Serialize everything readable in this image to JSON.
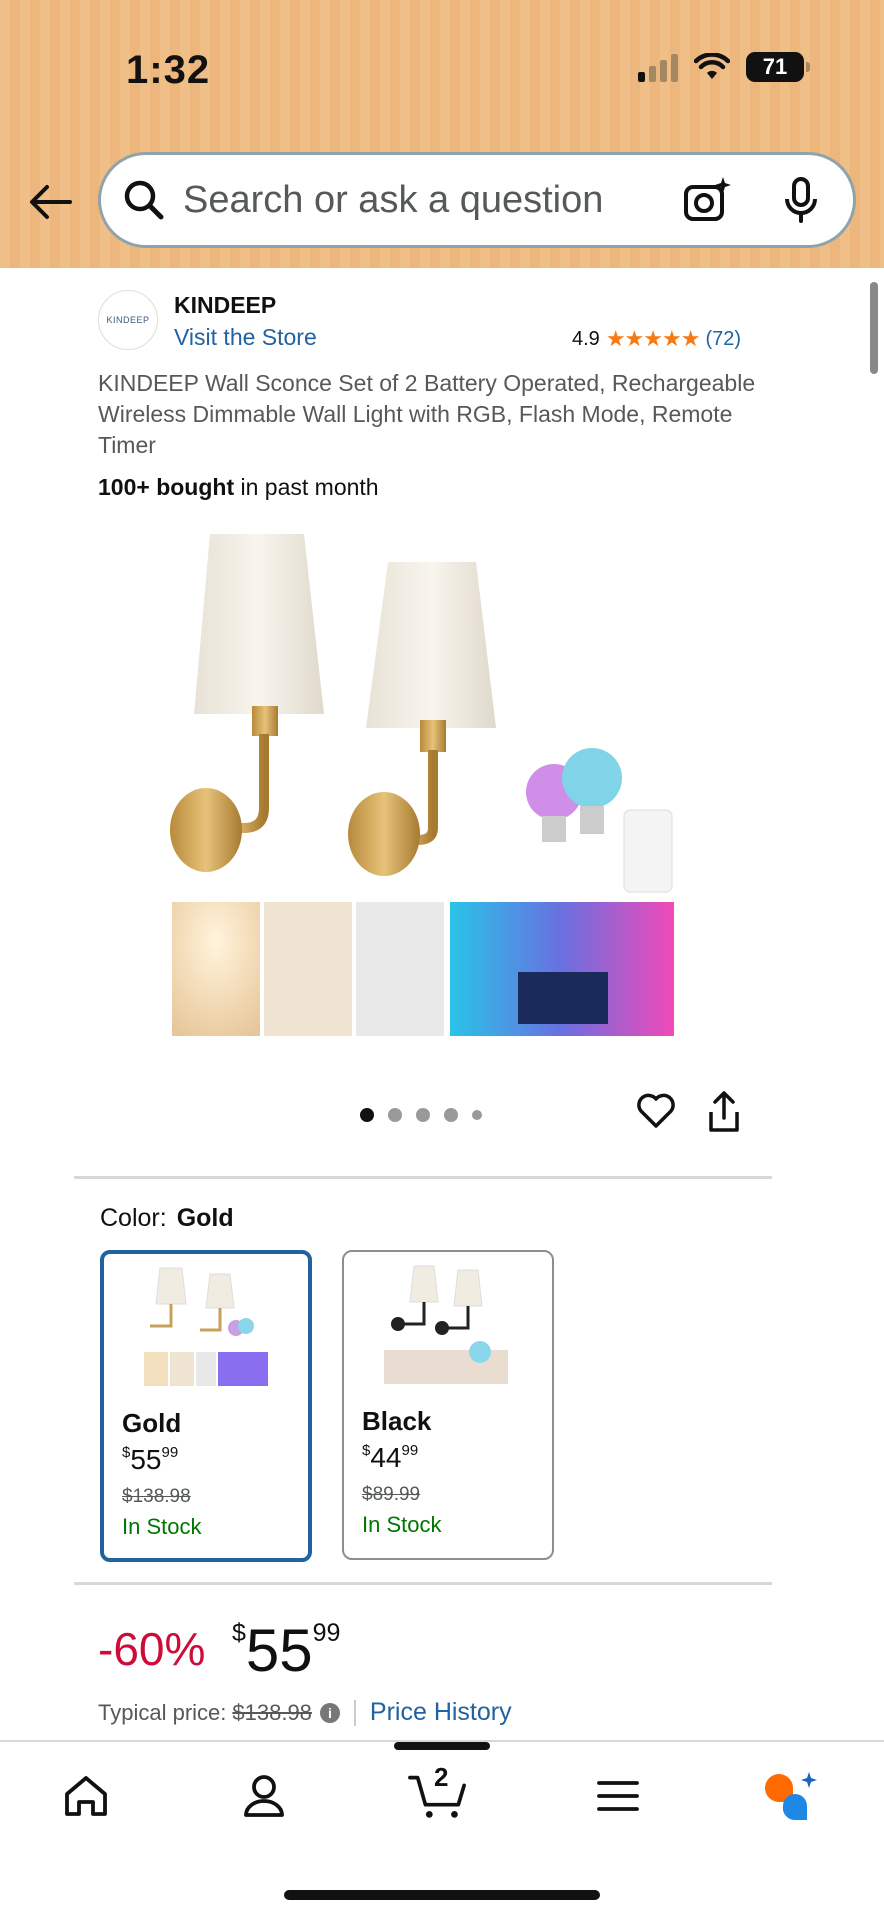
{
  "status_bar": {
    "time": "1:32",
    "battery": "71"
  },
  "search": {
    "placeholder": "Search or ask a question"
  },
  "brand": {
    "name": "KINDEEP",
    "logo_text": "KINDEEP",
    "visit_store": "Visit the Store"
  },
  "rating": {
    "value": "4.9",
    "stars": "★★★★★",
    "count": "(72)"
  },
  "product": {
    "title": "KINDEEP Wall Sconce Set of 2 Battery Operated, Rechargeable Wireless Dimmable Wall Light with RGB, Flash Mode, Remote Timer",
    "bought_bold": "100+ bought",
    "bought_rest": " in past month"
  },
  "carousel": {
    "total": 5,
    "active": 0
  },
  "color": {
    "label": "Color:",
    "selected": "Gold",
    "variants": [
      {
        "name": "Gold",
        "currency": "$",
        "price_whole": "55",
        "price_fraction": "99",
        "list_price": "$138.98",
        "stock": "In Stock"
      },
      {
        "name": "Black",
        "currency": "$",
        "price_whole": "44",
        "price_fraction": "99",
        "list_price": "$89.99",
        "stock": "In Stock"
      }
    ]
  },
  "price": {
    "discount": "-60%",
    "currency": "$",
    "whole": "55",
    "fraction": "99",
    "typical_label": "Typical price:",
    "typical_value": "$138.98",
    "price_history": "Price History"
  },
  "nav": {
    "cart_count": "2"
  },
  "colors": {
    "accent": "#2162a1",
    "deal": "#cc0c39",
    "stock": "#007600",
    "star": "#f77a12",
    "header": "#f0be87"
  }
}
